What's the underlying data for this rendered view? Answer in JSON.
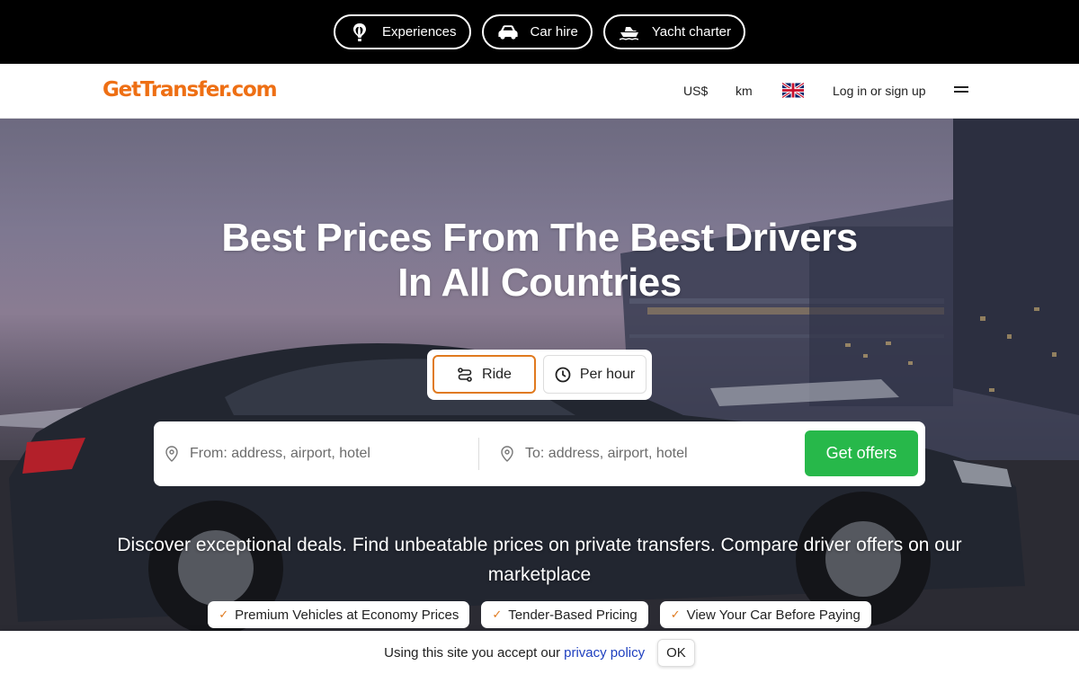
{
  "topbar": {
    "items": [
      {
        "label": "Experiences",
        "icon": "balloon-icon"
      },
      {
        "label": "Car hire",
        "icon": "car-icon"
      },
      {
        "label": "Yacht charter",
        "icon": "yacht-icon"
      }
    ]
  },
  "header": {
    "logo": "GetTransfer.com",
    "currency": "US$",
    "units": "km",
    "language_icon": "uk-flag-icon",
    "login": "Log in or sign up"
  },
  "hero": {
    "title_line1": "Best Prices From The Best Drivers",
    "title_line2": "In All Countries",
    "modes": {
      "ride": "Ride",
      "per_hour": "Per hour"
    },
    "search": {
      "from_placeholder": "From: address, airport, hotel",
      "to_placeholder": "To: address, airport, hotel",
      "submit": "Get offers"
    },
    "subtitle": "Discover exceptional deals. Find unbeatable prices on private transfers. Compare driver offers on our marketplace",
    "badges": [
      "Premium Vehicles at Economy Prices",
      "Tender-Based Pricing",
      "View Your Car Before Paying"
    ]
  },
  "cookie": {
    "text": "Using this site you accept our",
    "link": "privacy policy",
    "ok": "OK"
  },
  "colors": {
    "brand_orange": "#ee6f14",
    "accent_green": "#27b84a",
    "link_blue": "#1e3fbf"
  }
}
